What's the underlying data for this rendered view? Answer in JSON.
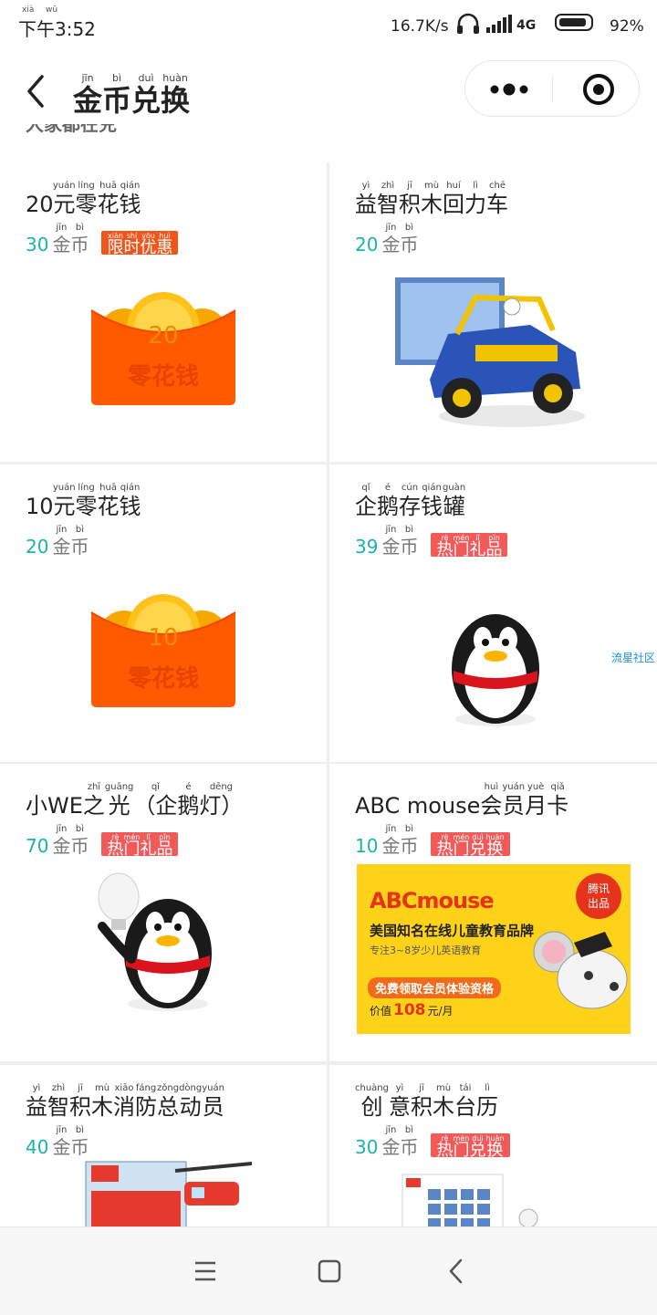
{
  "status_bar": {
    "time": "下午3:52",
    "time_ruby": [
      "xià",
      "wǔ"
    ],
    "net_speed": "16.7K/s",
    "network": "4G",
    "battery_percent": "92%",
    "battery_level": 0.92
  },
  "nav": {
    "title_chars": [
      "金",
      "币",
      "兑",
      "换"
    ],
    "title_pinyin": [
      "jīn",
      "bì",
      "duì",
      "huàn"
    ]
  },
  "clipped_header": "大家都在兑",
  "products": [
    {
      "name_pre": "20元",
      "name_chars": [
        "零",
        "花",
        "钱"
      ],
      "name_pinyin": [
        "yuán",
        "líng",
        "huā",
        "qián"
      ],
      "price": "30",
      "unit": "金币",
      "unit_pinyin": [
        "jīn",
        "bì"
      ],
      "badge_chars": [
        "限",
        "时",
        "优",
        "惠"
      ],
      "badge_pinyin": [
        "xiàn",
        "shí",
        "yōu",
        "huì"
      ],
      "image": {
        "type": "red-envelope",
        "amount": "20",
        "label": "零花钱"
      }
    },
    {
      "name_pre": "",
      "name_chars": [
        "益",
        "智",
        "积",
        "木",
        "回",
        "力",
        "车"
      ],
      "name_pinyin": [
        "yì",
        "zhì",
        "jī",
        "mù",
        "huí",
        "lì",
        "chē"
      ],
      "price": "20",
      "unit": "金币",
      "unit_pinyin": [
        "jīn",
        "bì"
      ],
      "badge_chars": [],
      "badge_pinyin": [],
      "image": {
        "type": "toy-car"
      }
    },
    {
      "name_pre": "10元",
      "name_chars": [
        "零",
        "花",
        "钱"
      ],
      "name_pinyin": [
        "yuán",
        "líng",
        "huā",
        "qián"
      ],
      "price": "20",
      "unit": "金币",
      "unit_pinyin": [
        "jīn",
        "bì"
      ],
      "badge_chars": [],
      "badge_pinyin": [],
      "image": {
        "type": "red-envelope",
        "amount": "10",
        "label": "零花钱"
      }
    },
    {
      "name_pre": "",
      "name_chars": [
        "企",
        "鹅",
        "存",
        "钱",
        "罐"
      ],
      "name_pinyin": [
        "qǐ",
        "é",
        "cún",
        "qián",
        "guàn"
      ],
      "price": "39",
      "unit": "金币",
      "unit_pinyin": [
        "jīn",
        "bì"
      ],
      "badge_chars": [
        "热",
        "门",
        "礼",
        "品"
      ],
      "badge_pinyin": [
        "rè",
        "mén",
        "lǐ",
        "pǐn"
      ],
      "image": {
        "type": "penguin"
      }
    },
    {
      "name_pre": "小WE",
      "name_chars": [
        "之",
        "光",
        "（企",
        "鹅",
        "灯）"
      ],
      "name_pinyin": [
        "zhī",
        "guāng",
        "qǐ",
        "é",
        "dēng"
      ],
      "price": "70",
      "unit": "金币",
      "unit_pinyin": [
        "jīn",
        "bì"
      ],
      "badge_chars": [
        "热",
        "门",
        "礼",
        "品"
      ],
      "badge_pinyin": [
        "rè",
        "mén",
        "lǐ",
        "pǐn"
      ],
      "image": {
        "type": "penguin-lamp"
      }
    },
    {
      "name_pre": "ABC mouse ",
      "name_chars": [
        "会",
        "员",
        "月",
        "卡"
      ],
      "name_pinyin": [
        "huì",
        "yuán",
        "yuè",
        "qiǎ"
      ],
      "price": "10",
      "unit": "金币",
      "unit_pinyin": [
        "jīn",
        "bì"
      ],
      "badge_chars": [
        "热",
        "门",
        "兑",
        "换"
      ],
      "badge_pinyin": [
        "rè",
        "mén",
        "duì",
        "huàn"
      ],
      "image": {
        "type": "abc-banner",
        "logo": "ABCmouse",
        "headline": "美国知名在线儿童教育品牌",
        "sub": "专注3~8岁少儿英语教育",
        "cta": "免费领取会员体验资格",
        "value_prefix": "价值",
        "value_amount": "108",
        "value_suffix": "元/月",
        "corner_badge_line1": "腾讯",
        "corner_badge_line2": "出品"
      }
    },
    {
      "name_pre": "",
      "name_chars": [
        "益",
        "智",
        "积",
        "木",
        "消",
        "防",
        "总",
        "动",
        "员"
      ],
      "name_pinyin": [
        "yì",
        "zhì",
        "jī",
        "mù",
        "xiāo",
        "fáng",
        "zǒng",
        "dòng",
        "yuán"
      ],
      "price": "40",
      "unit": "金币",
      "unit_pinyin": [
        "jīn",
        "bì"
      ],
      "badge_chars": [],
      "badge_pinyin": [],
      "image": {
        "type": "fire-set"
      }
    },
    {
      "name_pre": "",
      "name_chars": [
        "创",
        "意",
        "积",
        "木",
        "台",
        "历"
      ],
      "name_pinyin": [
        "chuàng",
        "yì",
        "jī",
        "mù",
        "tái",
        "lì"
      ],
      "price": "30",
      "unit": "金币",
      "unit_pinyin": [
        "jīn",
        "bì"
      ],
      "badge_chars": [
        "热",
        "门",
        "兑",
        "换"
      ],
      "badge_pinyin": [
        "rè",
        "mén",
        "duì",
        "huàn"
      ],
      "image": {
        "type": "calendar"
      }
    }
  ],
  "watermark": "流星社区",
  "system_nav": {
    "icons": [
      "menu-icon",
      "home-icon",
      "back-icon"
    ]
  },
  "colors": {
    "price": "#1bb3ad",
    "badge_red": "#f25a5a",
    "badge_orange": "#f2551a",
    "envelope": "#ff5a00",
    "coin": "#ffc21a"
  }
}
